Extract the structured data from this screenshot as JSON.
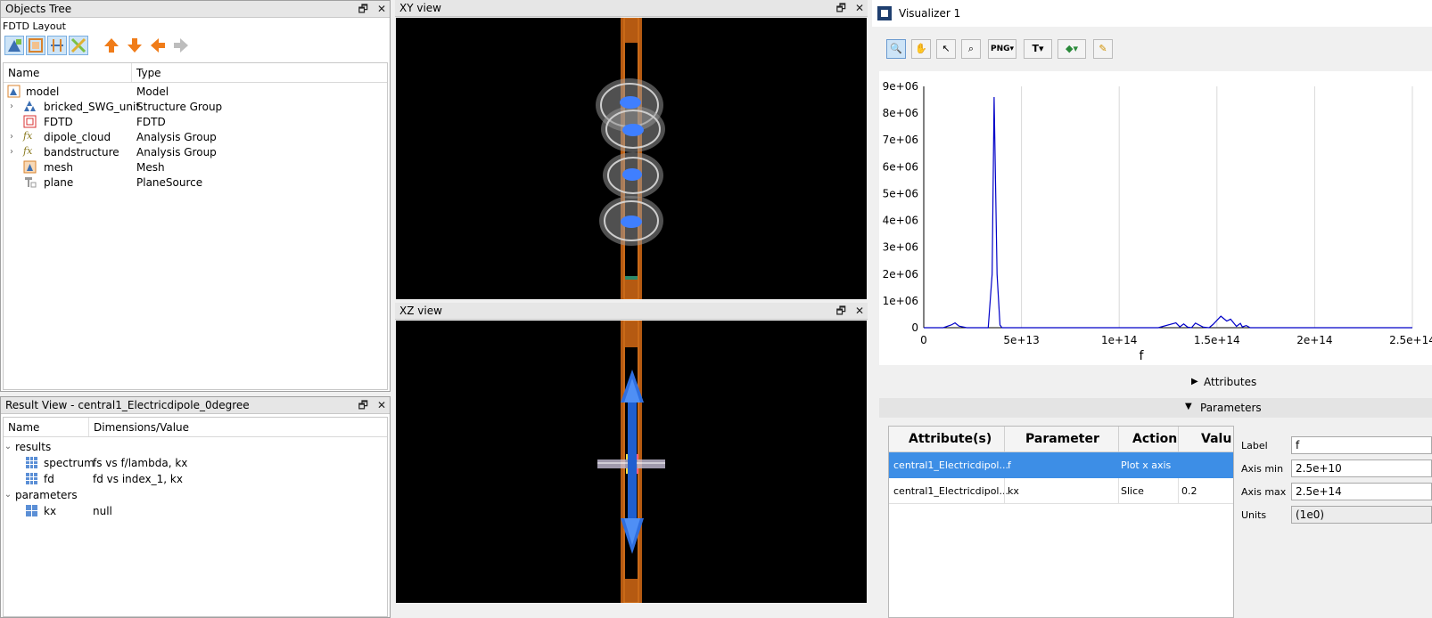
{
  "objects_tree": {
    "title": "Objects Tree",
    "layout_label": "FDTD Layout",
    "col_name": "Name",
    "col_type": "Type",
    "items": [
      {
        "name": "model",
        "type": "Model"
      },
      {
        "name": "bricked_SWG_unit",
        "type": "Structure Group"
      },
      {
        "name": "FDTD",
        "type": "FDTD"
      },
      {
        "name": "dipole_cloud",
        "type": "Analysis Group"
      },
      {
        "name": "bandstructure",
        "type": "Analysis Group"
      },
      {
        "name": "mesh",
        "type": "Mesh"
      },
      {
        "name": "plane",
        "type": "PlaneSource"
      }
    ]
  },
  "result_view": {
    "title": "Result View - central1_Electricdipole_0degree",
    "col_name": "Name",
    "col_value": "Dimensions/Value",
    "groups": [
      {
        "label": "results",
        "items": [
          {
            "name": "spectrum",
            "value": "fs vs f/lambda, kx"
          },
          {
            "name": "fd",
            "value": "fd vs index_1, kx"
          }
        ]
      },
      {
        "label": "parameters",
        "items": [
          {
            "name": "kx",
            "value": "null"
          }
        ]
      }
    ]
  },
  "xy_view": {
    "title": "XY view"
  },
  "xz_view": {
    "title": "XZ view"
  },
  "visualizer": {
    "title": "Visualizer 1",
    "toolbar_icons": [
      "zoom-icon",
      "pan-icon",
      "select-icon",
      "zoom-region-icon",
      "png-export-icon",
      "text-icon",
      "marker-icon",
      "pencil-icon"
    ],
    "png_label": "PNG",
    "attributes_label": "Attributes",
    "parameters_label": "Parameters",
    "table_headers": [
      "Attribute(s)",
      "Parameter",
      "Action",
      "Valu"
    ],
    "table_rows": [
      {
        "attr": "central1_Electricdipol...",
        "param": "f",
        "action": "Plot x axis",
        "value": ""
      },
      {
        "attr": "central1_Electricdipol...",
        "param": "kx",
        "action": "Slice",
        "value": "0.2"
      }
    ],
    "props": {
      "label_lbl": "Label",
      "label_val": "f",
      "axis_min_lbl": "Axis min",
      "axis_min_val": "2.5e+10",
      "axis_max_lbl": "Axis max",
      "axis_max_val": "2.5e+14",
      "units_lbl": "Units",
      "units_val": "(1e0)"
    }
  },
  "chart_data": {
    "type": "line",
    "xlabel": "f",
    "ylabel": "",
    "xlim": [
      0,
      250000000000000.0
    ],
    "ylim": [
      0,
      9000000.0
    ],
    "x_ticks": [
      "0",
      "5e+13",
      "1e+14",
      "1.5e+14",
      "2e+14",
      "2.5e+14"
    ],
    "x_tick_values": [
      0,
      50000000000000.0,
      100000000000000.0,
      150000000000000.0,
      200000000000000.0,
      250000000000000.0
    ],
    "y_ticks": [
      "0",
      "1e+06",
      "2e+06",
      "3e+06",
      "4e+06",
      "5e+06",
      "6e+06",
      "7e+06",
      "8e+06",
      "9e+06"
    ],
    "y_tick_values": [
      0,
      1000000.0,
      2000000.0,
      3000000.0,
      4000000.0,
      5000000.0,
      6000000.0,
      7000000.0,
      8000000.0,
      9000000.0
    ],
    "grid": true,
    "line_color": "#0000c8",
    "series": [
      {
        "x": [
          25000000000.0,
          10000000000000.0,
          14000000000000.0,
          16000000000000.0,
          18000000000000.0,
          22000000000000.0,
          33000000000000.0,
          35000000000000.0,
          36000000000000.0,
          37500000000000.0,
          39000000000000.0,
          40000000000000.0,
          42000000000000.0,
          60000000000000.0,
          90000000000000.0,
          120000000000000.0,
          129000000000000.0,
          131000000000000.0,
          133000000000000.0,
          135000000000000.0,
          137000000000000.0,
          139000000000000.0,
          143000000000000.0,
          146000000000000.0,
          148000000000000.0,
          152000000000000.0,
          155000000000000.0,
          157000000000000.0,
          160000000000000.0,
          162000000000000.0,
          163000000000000.0,
          165000000000000.0,
          167000000000000.0,
          169000000000000.0,
          172000000000000.0,
          200000000000000.0,
          250000000000000.0
        ],
        "y": [
          0,
          0,
          100000.0,
          180000.0,
          60000.0,
          0,
          0,
          2000000.0,
          8600000.0,
          2000000.0,
          100000.0,
          0,
          0,
          0,
          0,
          0,
          180000.0,
          30000.0,
          140000.0,
          20000.0,
          0,
          170000.0,
          20000.0,
          0,
          120000.0,
          430000.0,
          250000.0,
          320000.0,
          50000.0,
          160000.0,
          30000.0,
          80000.0,
          0,
          0,
          0,
          0,
          0
        ]
      }
    ]
  }
}
